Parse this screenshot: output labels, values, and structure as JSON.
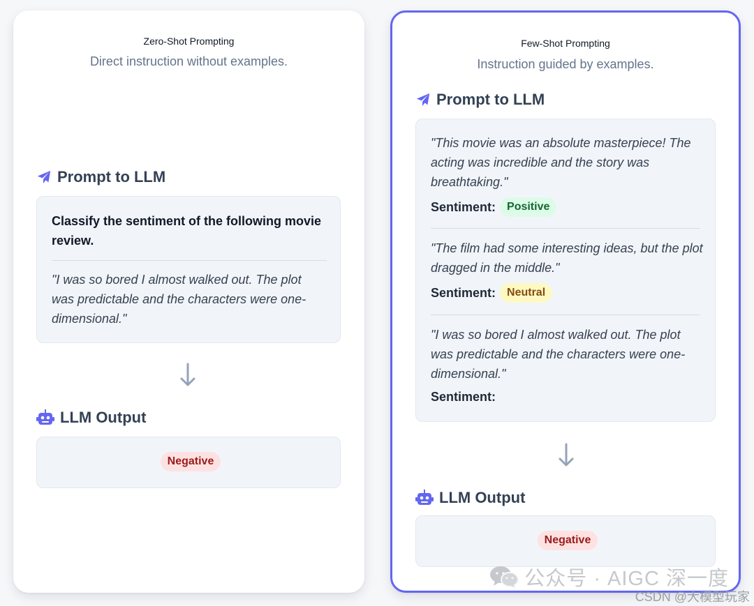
{
  "zero_shot": {
    "title": "Zero-Shot Prompting",
    "subtitle": "Direct instruction without examples.",
    "prompt_heading": "Prompt to LLM",
    "instruction": "Classify the sentiment of the following movie review.",
    "review": "\"I was so bored I almost walked out. The plot was predictable and the characters were one-dimensional.\"",
    "output_heading": "LLM Output",
    "output_label": "Negative"
  },
  "few_shot": {
    "title": "Few-Shot Prompting",
    "subtitle": "Instruction guided by examples.",
    "prompt_heading": "Prompt to LLM",
    "sentiment_label": "Sentiment:",
    "examples": [
      {
        "review": "\"This movie was an absolute masterpiece! The acting was incredible and the story was breathtaking.\"",
        "sentiment": "Positive"
      },
      {
        "review": "\"The film had some interesting ideas, but the plot dragged in the middle.\"",
        "sentiment": "Neutral"
      },
      {
        "review": "\"I was so bored I almost walked out. The plot was predictable and the characters were one-dimensional.\"",
        "sentiment": ""
      }
    ],
    "output_heading": "LLM Output",
    "output_label": "Negative"
  },
  "watermark": {
    "text": "公众号 · AIGC 深一度",
    "credit": "CSDN @大模型玩家"
  },
  "icons": {
    "prompt": "paper-plane-icon",
    "output": "robot-icon",
    "arrow": "arrow-down-icon",
    "watermark": "wechat-icon"
  },
  "colors": {
    "accent": "#6366f1",
    "heading": "#334155",
    "positive_bg": "#dcfce7",
    "neutral_bg": "#fef9c3",
    "negative_bg": "#fee2e2"
  }
}
